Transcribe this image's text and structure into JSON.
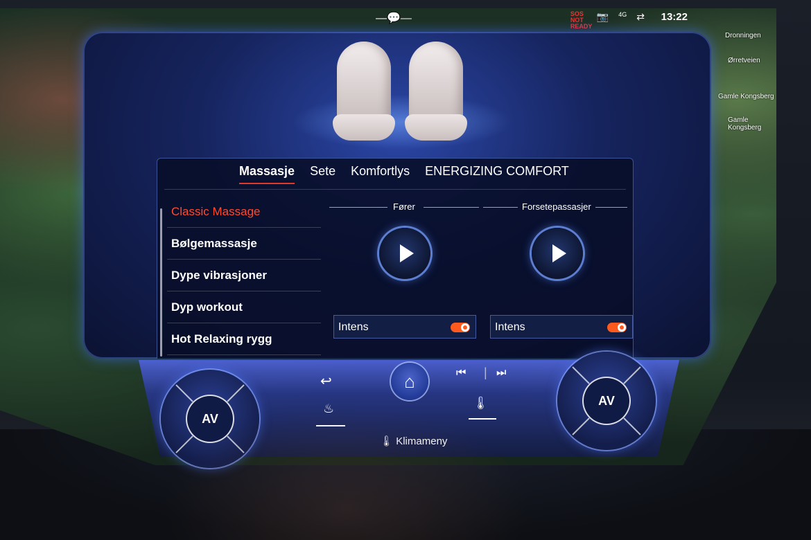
{
  "status": {
    "time": "13:22",
    "red_label": "SOS NOT READY",
    "signal": "4G"
  },
  "map": {
    "labels": [
      "Dronningen",
      "Ørretveien",
      "Gamle Kongsberg",
      "Gamle Kongsberg"
    ]
  },
  "tabs": [
    {
      "label": "Massasje",
      "active": true
    },
    {
      "label": "Sete",
      "active": false
    },
    {
      "label": "Komfortlys",
      "active": false
    },
    {
      "label": "ENERGIZING COMFORT",
      "active": false
    }
  ],
  "programs": [
    {
      "label": "Classic Massage",
      "selected": true
    },
    {
      "label": "Bølgemassasje",
      "selected": false
    },
    {
      "label": "Dype vibrasjoner",
      "selected": false
    },
    {
      "label": "Dyp workout",
      "selected": false
    },
    {
      "label": "Hot Relaxing rygg",
      "selected": false
    }
  ],
  "driver": {
    "heading": "Fører",
    "intens_label": "Intens",
    "intens_on": true
  },
  "passenger": {
    "heading": "Forsetepassasjer",
    "intens_label": "Intens",
    "intens_on": true
  },
  "climate": {
    "left_dial": "AV",
    "right_dial": "AV",
    "menu_label": "Klimameny"
  },
  "colors": {
    "accent": "#ff4a2e",
    "panel": "#16245e",
    "toggle": "#ff5a1e"
  }
}
